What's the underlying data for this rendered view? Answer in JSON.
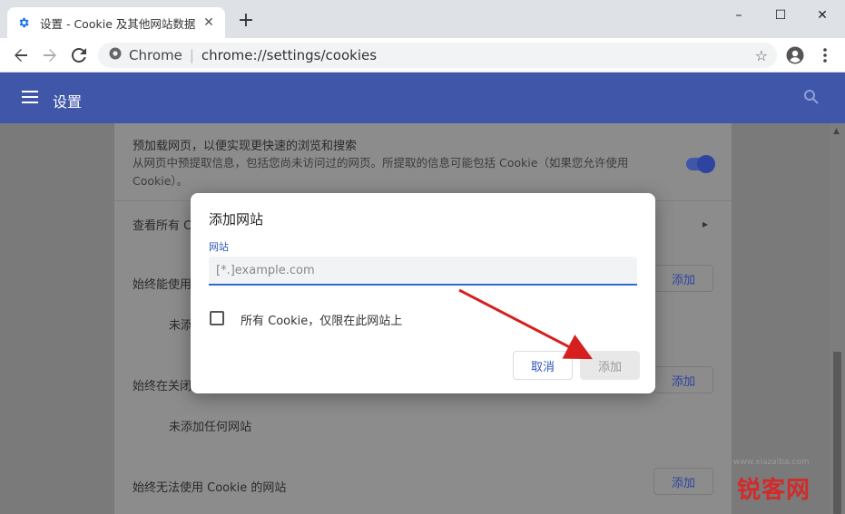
{
  "browser": {
    "tab_title": "设置 - Cookie 及其他网站数据",
    "new_tab_label": "+",
    "omnibox_secure_label": "Chrome",
    "omnibox_separator": "|",
    "url": "chrome://settings/cookies",
    "window_buttons": [
      "–",
      "☐",
      "✕"
    ]
  },
  "header": {
    "title": "设置"
  },
  "page": {
    "preload_title": "预加载网页，以便实现更快速的浏览和搜索",
    "preload_desc": "从网页中预提取信息，包括您尚未访问过的网页。所提取的信息可能包括 Cookie（如果您允许使用 Cookie）。",
    "preload_enabled": true,
    "see_all_label": "查看所有 C",
    "always_allow_label": "始终能使用",
    "always_allow_empty": "未添",
    "clear_on_exit_label": "始终在关闭",
    "clear_on_exit_empty": "未添加任何网站",
    "always_block_label": "始终无法使用 Cookie 的网站",
    "add_label": "添加"
  },
  "dialog": {
    "title": "添加网站",
    "field_label": "网站",
    "placeholder": "[*.]example.com",
    "checkbox_label": "所有 Cookie，仅限在此网站上",
    "checkbox_checked": false,
    "cancel_label": "取消",
    "add_label": "添加"
  },
  "watermark": {
    "text": "锐客网",
    "url": "www.xiazaiba.com"
  },
  "colors": {
    "brand_blue": "#3f56a9",
    "accent_blue": "#3367d6",
    "arrow_red": "#d62020"
  }
}
